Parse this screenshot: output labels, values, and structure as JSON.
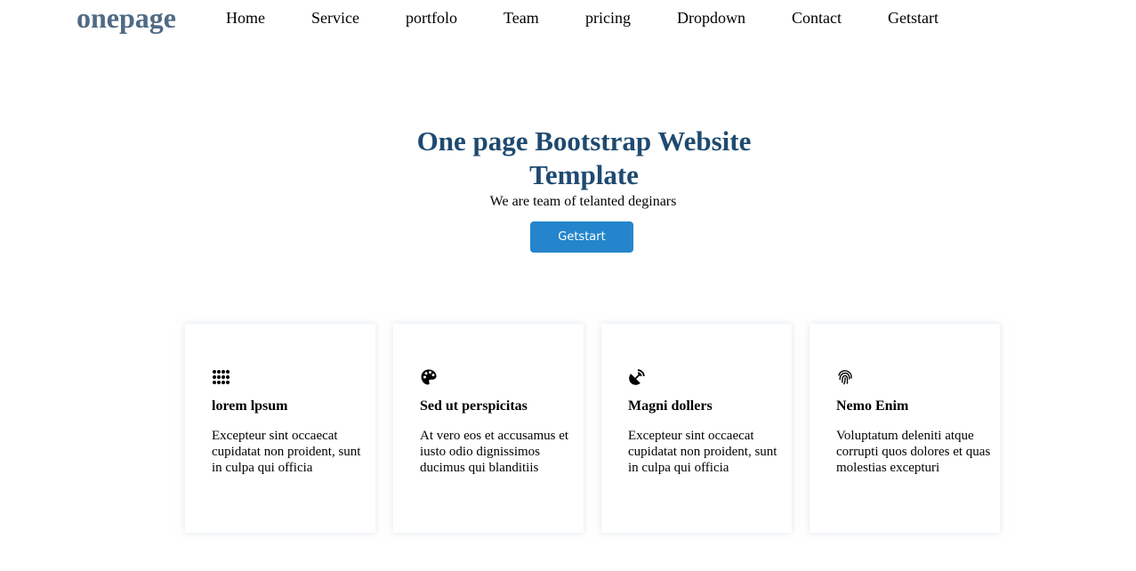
{
  "brand": {
    "logo": "onepage",
    "logo_color": "#4f6b85"
  },
  "nav": {
    "items": [
      {
        "label": "Home"
      },
      {
        "label": "Service"
      },
      {
        "label": "portfolo"
      },
      {
        "label": "Team"
      },
      {
        "label": "pricing"
      },
      {
        "label": "Dropdown"
      },
      {
        "label": "Contact"
      },
      {
        "label": "Getstart"
      }
    ]
  },
  "hero": {
    "title": "One page Bootstrap Website Template",
    "subtitle": "We are team of telanted deginars",
    "button_label": "Getstart",
    "title_color": "#1f4a70",
    "button_color": "#2485cc"
  },
  "services": [
    {
      "icon": "grid-dots-icon",
      "title": "lorem lpsum",
      "text": "Excepteur sint occaecat cupidatat non proident, sunt in culpa qui officia"
    },
    {
      "icon": "palette-icon",
      "title": "Sed ut perspicitas",
      "text": "At vero eos et accusamus et iusto odio dignissimos ducimus qui blanditiis"
    },
    {
      "icon": "satellite-dish-icon",
      "title": "Magni dollers",
      "text": "Excepteur sint occaecat cupidatat non proident, sunt in culpa qui officia"
    },
    {
      "icon": "fingerprint-icon",
      "title": "Nemo Enim",
      "text": "Voluptatum deleniti atque corrupti quos dolores et quas molestias excepturi"
    }
  ]
}
